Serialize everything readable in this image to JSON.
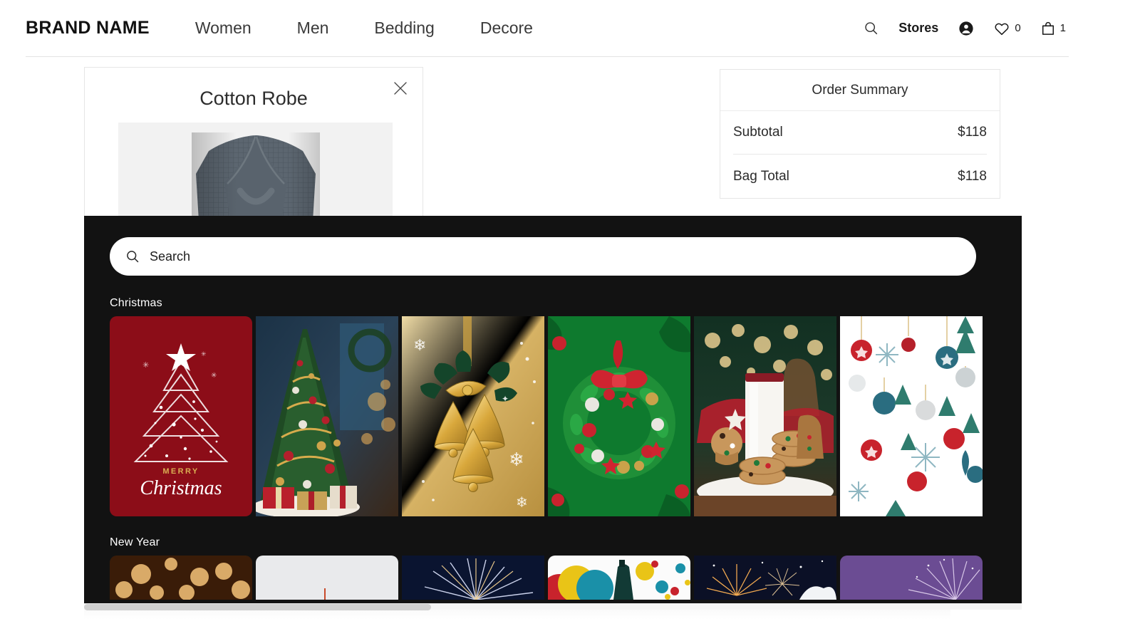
{
  "header": {
    "brand": "BRAND NAME",
    "nav": [
      {
        "label": "Women"
      },
      {
        "label": "Men"
      },
      {
        "label": "Bedding"
      },
      {
        "label": "Decore"
      }
    ],
    "search_icon": "search-icon",
    "stores_label": "Stores",
    "account_icon": "account-icon",
    "wishlist_icon": "heart-icon",
    "wishlist_count": "0",
    "bag_icon": "bag-icon",
    "bag_count": "1"
  },
  "product_card": {
    "title": "Cotton Robe",
    "close_icon": "close-icon",
    "image_alt": "grey-cotton-robe"
  },
  "order_summary": {
    "heading": "Order Summary",
    "rows": [
      {
        "label": "Subtotal",
        "value": "$118"
      },
      {
        "label": "Bag Total",
        "value": "$118"
      }
    ]
  },
  "overlay": {
    "search": {
      "placeholder": "Search",
      "value": "",
      "icon": "search-icon"
    },
    "sections": [
      {
        "label": "Christmas",
        "tiles": [
          {
            "name": "merry-christmas-card",
            "caption_small": "MERRY",
            "caption_script": "Christmas"
          },
          {
            "name": "decorated-christmas-tree"
          },
          {
            "name": "golden-bells"
          },
          {
            "name": "green-wreath"
          },
          {
            "name": "milk-and-cookies"
          },
          {
            "name": "ornament-pattern"
          }
        ]
      },
      {
        "label": "New Year",
        "tiles": [
          {
            "name": "golden-bokeh-lights"
          },
          {
            "name": "white-celebration"
          },
          {
            "name": "blue-fireworks"
          },
          {
            "name": "balloons-and-confetti"
          },
          {
            "name": "fireworks-night-sky"
          },
          {
            "name": "purple-fireworks"
          }
        ]
      }
    ]
  },
  "scrollbar": {
    "orientation": "horizontal"
  },
  "colors": {
    "overlay_bg": "#121212",
    "card_red": "#8c0d18",
    "gold": "#c9a23d",
    "wreath_green": "#0e7a2e",
    "purple": "#6b4c93"
  }
}
